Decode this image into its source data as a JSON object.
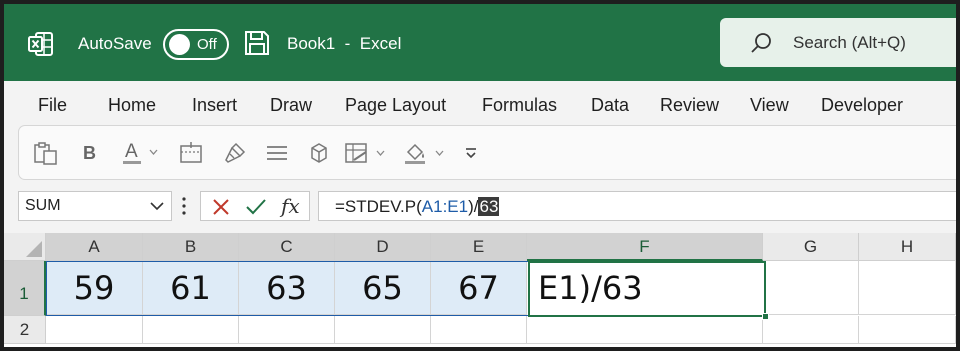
{
  "titlebar": {
    "autosave_label": "AutoSave",
    "autosave_state": "Off",
    "doc_name": "Book1",
    "separator": "-",
    "app_name": "Excel",
    "search_placeholder": "Search (Alt+Q)",
    "brand_color": "#217346"
  },
  "menu": {
    "items": [
      "File",
      "Home",
      "Insert",
      "Draw",
      "Page Layout",
      "Formulas",
      "Data",
      "Review",
      "View",
      "Developer"
    ]
  },
  "ribbon": {
    "icons": [
      "paste-icon",
      "bold-icon",
      "font-color-icon",
      "borders-icon",
      "format-painter-icon",
      "align-icon",
      "merge-icon",
      "conditional-format-icon",
      "fill-color-icon",
      "more-options-icon"
    ],
    "bold_label": "B",
    "font_color_label": "A"
  },
  "formula_bar": {
    "name_box": "SUM",
    "fx_label": "fx",
    "formula_prefix": "=STDEV.P(",
    "formula_ref": "A1:E1",
    "formula_suffix": ")/",
    "formula_selected": "63"
  },
  "grid": {
    "columns": [
      "A",
      "B",
      "C",
      "D",
      "E",
      "F",
      "G",
      "H"
    ],
    "rows": [
      "1",
      "2"
    ],
    "row1_values": [
      "59",
      "61",
      "63",
      "65",
      "67"
    ],
    "editing_cell_text": "E1)/63",
    "range_color": "#1e5ca8",
    "active_color": "#217346"
  }
}
